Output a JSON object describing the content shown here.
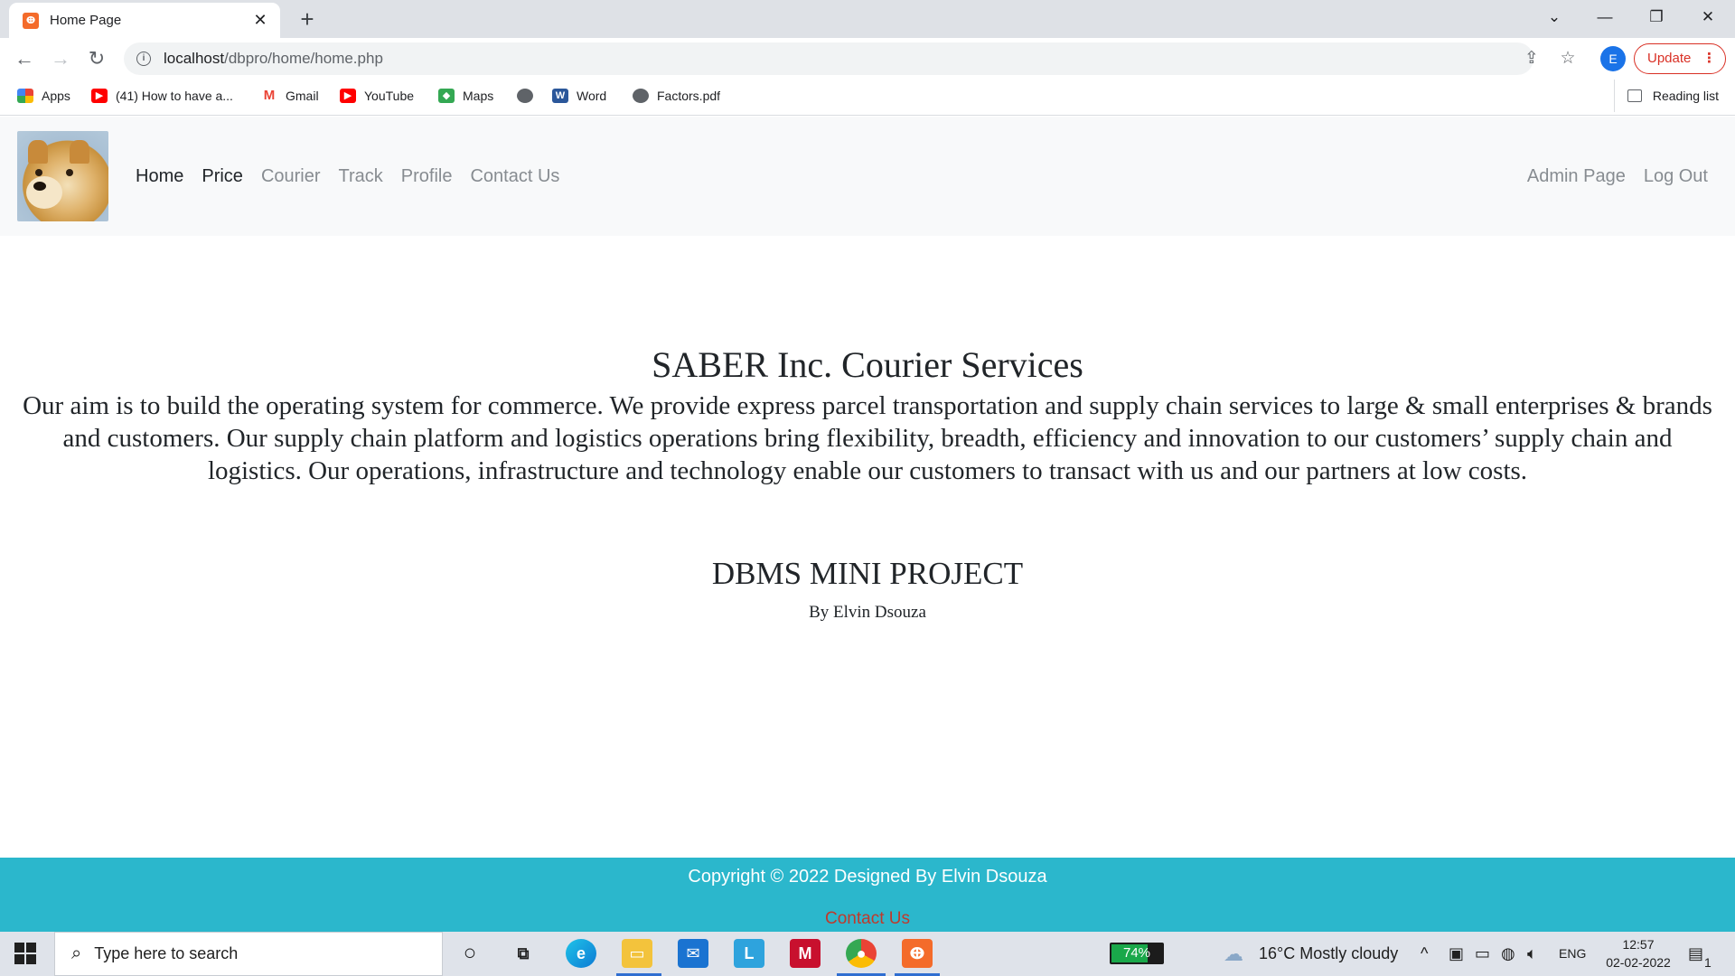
{
  "browser": {
    "tab_title": "Home Page",
    "tab_close": "✕",
    "new_tab": "+",
    "url_host": "localhost",
    "url_path": "/dbpro/home/home.php",
    "profile_initial": "E",
    "update_label": "Update"
  },
  "bookmarks": [
    {
      "label": "Apps",
      "icon": "apps-grid-icon"
    },
    {
      "label": "(41) How to have a...",
      "icon": "youtube-icon"
    },
    {
      "label": "Gmail",
      "icon": "gmail-icon"
    },
    {
      "label": "YouTube",
      "icon": "youtube-icon"
    },
    {
      "label": "Maps",
      "icon": "maps-icon"
    },
    {
      "label": "",
      "icon": "globe-icon"
    },
    {
      "label": "Word",
      "icon": "word-icon"
    },
    {
      "label": "Factors.pdf",
      "icon": "globe-icon"
    }
  ],
  "reading_list": "Reading list",
  "nav": {
    "links": [
      "Home",
      "Price",
      "Courier",
      "Track",
      "Profile",
      "Contact Us"
    ],
    "right_links": [
      "Admin Page",
      "Log Out"
    ]
  },
  "hero": {
    "title": "SABER Inc. Courier Services",
    "description": "Our aim is to build the operating system for commerce. We provide express parcel transportation and supply chain services to large & small enterprises & brands and customers. Our supply chain platform and logistics operations bring flexibility, breadth, efficiency and innovation to our customers’ supply chain and logistics. Our operations, infrastructure and technology enable our customers to transact with us and our partners at low costs."
  },
  "project": {
    "title": "DBMS MINI PROJECT",
    "author": "By Elvin Dsouza"
  },
  "footer": {
    "copyright": "Copyright © 2022 Designed By Elvin Dsouza",
    "contact": "Contact Us"
  },
  "taskbar": {
    "search_placeholder": "Type here to search",
    "battery": "74%",
    "battery_level": 0.74,
    "weather": "16°C  Mostly cloudy",
    "language": "ENG",
    "time": "12:57",
    "date": "02-02-2022",
    "notifications": "1"
  },
  "colors": {
    "footer_bg": "#2bb7cc",
    "contact_link": "#c0392b",
    "update_red": "#d93025"
  }
}
